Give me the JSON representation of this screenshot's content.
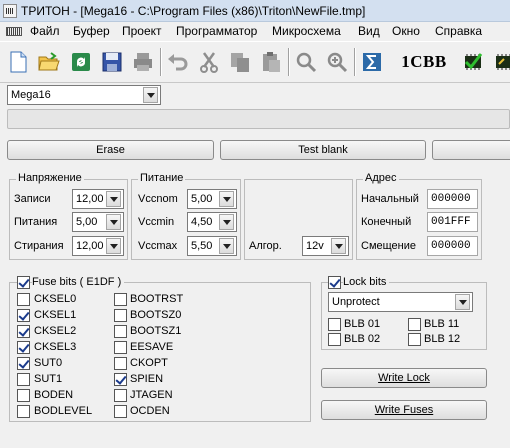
{
  "window": {
    "title": "ТРИТОН - [Mega16 - C:\\Program Files (x86)\\Triton\\NewFile.tmp]"
  },
  "menu": [
    "Файл",
    "Буфер",
    "Проект",
    "Программатор",
    "Микросхема",
    "Вид",
    "Окно",
    "Справка"
  ],
  "toolbar": {
    "icons": [
      "new-file-icon",
      "open-folder-icon",
      "refresh-icon",
      "save-icon",
      "print-icon",
      "undo-icon",
      "cut-icon",
      "copy-icon",
      "paste-icon",
      "search-icon",
      "zoom-icon",
      "calc-sum-icon",
      "checksum-icon",
      "chip-verify-icon",
      "chip-icon"
    ],
    "checksum_label": "1CBB"
  },
  "device": {
    "selected": "Mega16"
  },
  "progress": {
    "fraction": 0
  },
  "actions": {
    "erase": "Erase",
    "test_blank": "Test  blank"
  },
  "voltage": {
    "title": "Напряжение",
    "rows": [
      {
        "label": "Записи",
        "value": "12,00"
      },
      {
        "label": "Питания",
        "value": "5,00"
      },
      {
        "label": "Стирания",
        "value": "12,00"
      }
    ]
  },
  "power": {
    "title": "Питание",
    "rows": [
      {
        "label": "Vccnom",
        "value": "5,00"
      },
      {
        "label": "Vccmin",
        "value": "4,50"
      },
      {
        "label": "Vccmax",
        "value": "5,50"
      }
    ]
  },
  "algorithm": {
    "label": "Алгор.",
    "value": "12v"
  },
  "address": {
    "title": "Адрес",
    "rows": [
      {
        "label": "Начальный",
        "value": "000000"
      },
      {
        "label": "Конечный",
        "value": "001FFF"
      },
      {
        "label": "Смещение",
        "value": "000000"
      }
    ]
  },
  "fuse": {
    "title": "Fuse bits  ( E1DF )",
    "enabled": true,
    "left": [
      {
        "name": "CKSEL0",
        "checked": false
      },
      {
        "name": "CKSEL1",
        "checked": true
      },
      {
        "name": "CKSEL2",
        "checked": true
      },
      {
        "name": "CKSEL3",
        "checked": true
      },
      {
        "name": "SUT0",
        "checked": true
      },
      {
        "name": "SUT1",
        "checked": false
      },
      {
        "name": "BODEN",
        "checked": false
      },
      {
        "name": "BODLEVEL",
        "checked": false
      }
    ],
    "right": [
      {
        "name": "BOOTRST",
        "checked": false
      },
      {
        "name": "BOOTSZ0",
        "checked": false
      },
      {
        "name": "BOOTSZ1",
        "checked": false
      },
      {
        "name": "EESAVE",
        "checked": false
      },
      {
        "name": "CKOPT",
        "checked": false
      },
      {
        "name": "SPIEN",
        "checked": true
      },
      {
        "name": "JTAGEN",
        "checked": false
      },
      {
        "name": "OCDEN",
        "checked": false
      }
    ]
  },
  "lock": {
    "title": "Lock bits",
    "enabled": true,
    "mode": "Unprotect",
    "bits": [
      {
        "name": "BLB 01",
        "checked": false
      },
      {
        "name": "BLB 11",
        "checked": false
      },
      {
        "name": "BLB 02",
        "checked": false
      },
      {
        "name": "BLB 12",
        "checked": false
      }
    ]
  },
  "buttons": {
    "write_lock": "Write Lock",
    "write_fuses": "Write Fuses"
  }
}
